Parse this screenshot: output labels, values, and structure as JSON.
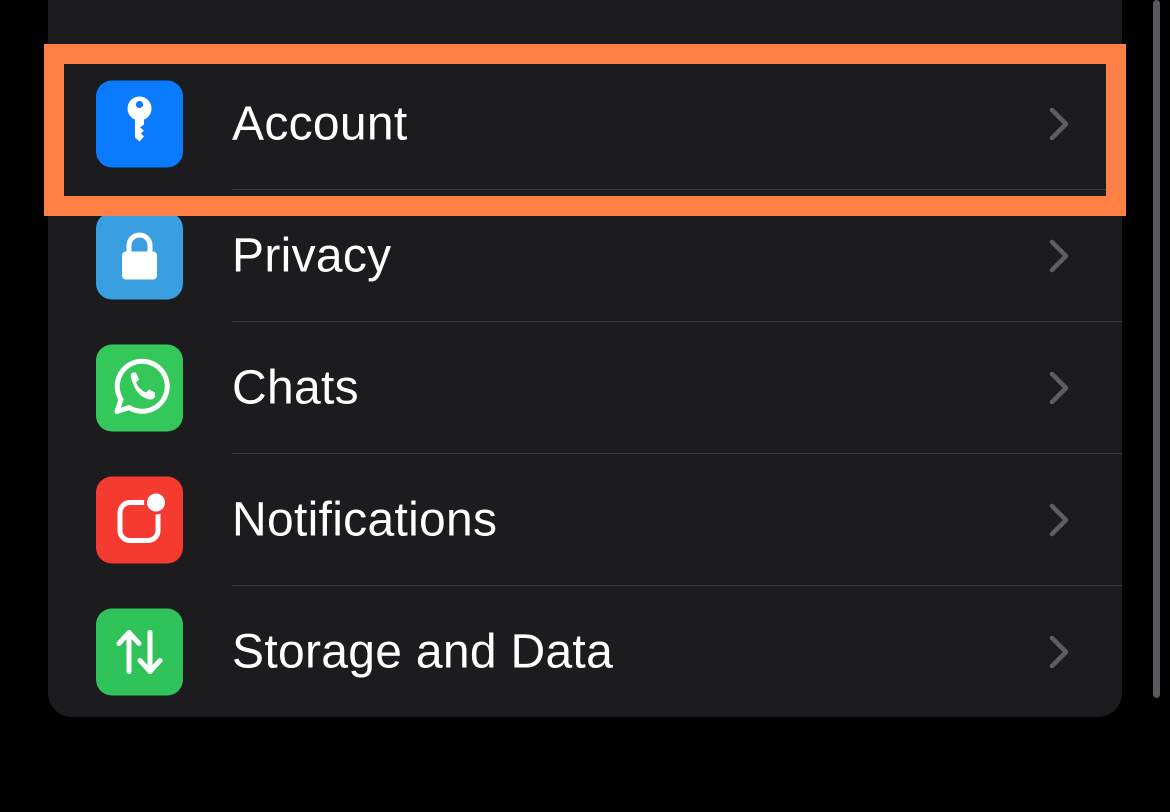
{
  "settings": {
    "items": [
      {
        "label": "Account",
        "icon": "key-icon",
        "icon_color": "#0a7aff",
        "chevron": "chevron-right-icon"
      },
      {
        "label": "Privacy",
        "icon": "lock-icon",
        "icon_color": "#3a9fe0",
        "chevron": "chevron-right-icon"
      },
      {
        "label": "Chats",
        "icon": "whatsapp-icon",
        "icon_color": "#34c759",
        "chevron": "chevron-right-icon"
      },
      {
        "label": "Notifications",
        "icon": "notification-badge-icon",
        "icon_color": "#f53a30",
        "chevron": "chevron-right-icon"
      },
      {
        "label": "Storage and Data",
        "icon": "up-down-arrows-icon",
        "icon_color": "#30c35a",
        "chevron": "chevron-right-icon"
      }
    ]
  },
  "highlight": {
    "target": "Account",
    "color": "#ff7f45"
  },
  "theme": {
    "background": "#000000",
    "group_background": "#1c1c1e",
    "separator": "#3a3a3c",
    "chevron": "#5e5e62"
  }
}
